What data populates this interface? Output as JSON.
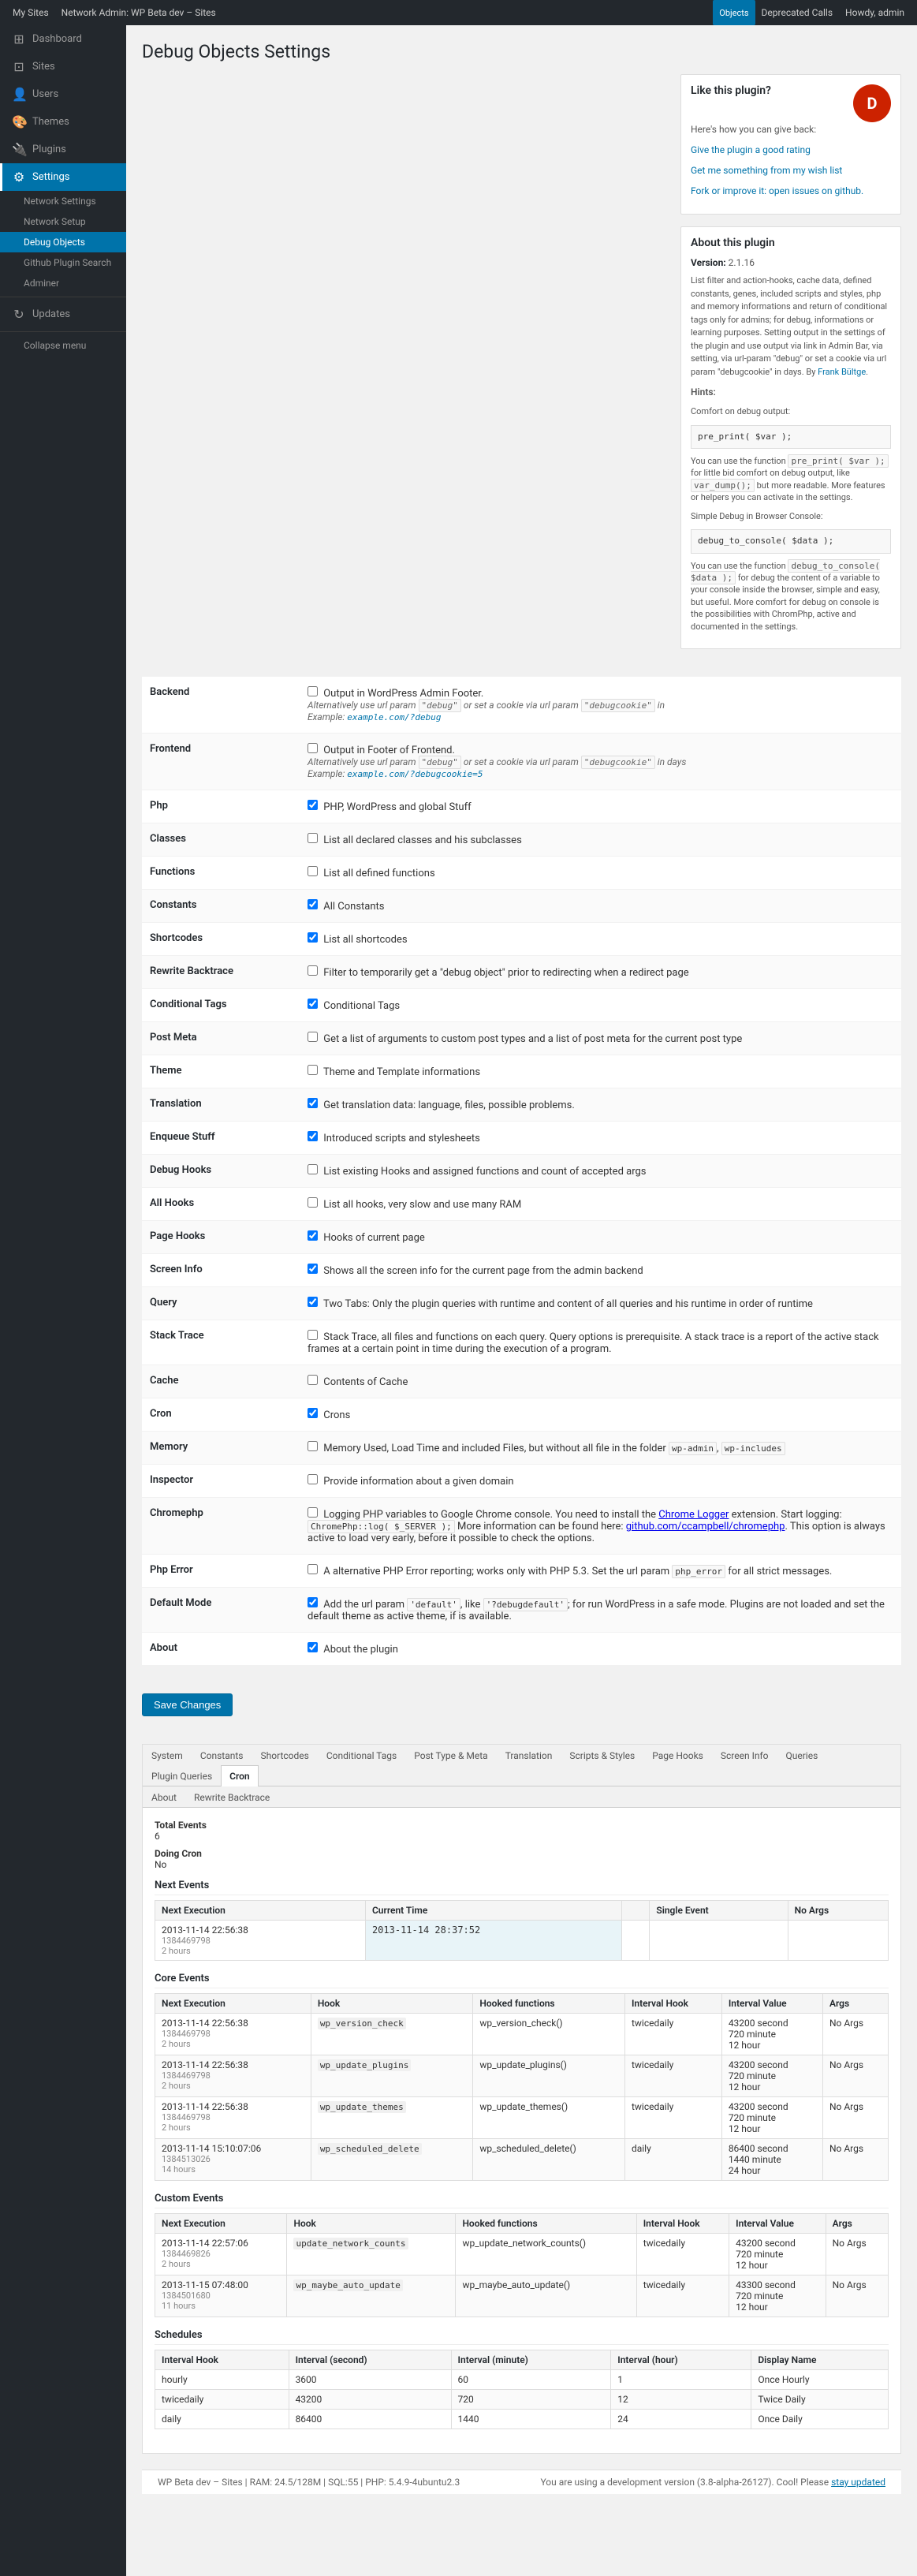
{
  "adminbar": {
    "my_sites": "My Sites",
    "network_admin": "Network Admin: WP Beta dev – Sites",
    "objects": "Objects",
    "deprecated_calls": "Deprecated Calls",
    "howdy": "Howdy, admin"
  },
  "sidebar": {
    "items": [
      {
        "id": "dashboard",
        "label": "Dashboard",
        "icon": "⊞"
      },
      {
        "id": "sites",
        "label": "Sites",
        "icon": "⊞"
      },
      {
        "id": "users",
        "label": "Users",
        "icon": "👤"
      },
      {
        "id": "themes",
        "label": "Themes",
        "icon": "🎨"
      },
      {
        "id": "plugins",
        "label": "Plugins",
        "icon": "🔌"
      },
      {
        "id": "settings",
        "label": "Settings",
        "icon": "⚙",
        "current": true
      }
    ],
    "settings_submenu": [
      {
        "id": "network-settings",
        "label": "Network Settings"
      },
      {
        "id": "network-setup",
        "label": "Network Setup"
      },
      {
        "id": "debug-objects",
        "label": "Debug Objects",
        "current": true
      },
      {
        "id": "github-plugin-search",
        "label": "Github Plugin Search"
      },
      {
        "id": "adminer",
        "label": "Adminer"
      }
    ],
    "updates": "Updates",
    "collapse": "Collapse menu"
  },
  "page": {
    "title": "Debug Objects Settings"
  },
  "like_plugin": {
    "title": "Like this plugin?",
    "body": "Here's how you can give back:",
    "links": [
      "Give the plugin a good rating",
      "Get me something from my wish list",
      "Fork or improve it: open issues on github."
    ]
  },
  "about_plugin": {
    "title": "About this plugin",
    "version_label": "Version:",
    "version_value": "2.1.16",
    "description": "List filter and action-hooks, cache data, defined constants, genes, included scripts and styles, php and memory informations and return of conditional tags only for admins; for debug, informations or learning purposes. Setting output in the settings of the plugin and use output via link in Admin Bar, via setting, via url-param \"debug\" or set a cookie via url param \"debugcookie\" in days. By Frank Bültge.",
    "hints_title": "Hints:",
    "hint1": "Comfort on debug output:",
    "code1": "pre_print( $var );",
    "hint2": "You can use the function pre_print( $var ); for little bid comfort on debug output, like var_dump(); but more readable. More features or helpers you can activate in the settings.",
    "hint3": "Simple Debug in Browser Console:",
    "code2": "debug_to_console( $data );",
    "hint4": "You can use the function debug_to_console( $data ); for debug the content of a variable to your console inside the browser, simple and easy, but useful. More comfort for debug on console is the possibilities with ChromPhp, active and documented in the settings."
  },
  "form_fields": [
    {
      "id": "backend",
      "label": "Backend",
      "checkbox": false,
      "text": "Output in WordPress Admin Footer.",
      "detail": "Alternatively use url param \"debug\" or set a cookie via url param \"debugcookie\" in",
      "example_label": "Example:",
      "example_value": "example.com/?debug"
    },
    {
      "id": "frontend",
      "label": "Frontend",
      "checkbox": false,
      "text": "Output in Footer of Frontend.",
      "detail": "Alternatively use url param \"debug\" or set a cookie via url param \"debugcookie\" in days",
      "example_label": "Example:",
      "example_value": "example.com/?debugcookie=5"
    },
    {
      "id": "php",
      "label": "Php",
      "checkbox": true,
      "text": "PHP, WordPress and global Stuff"
    },
    {
      "id": "classes",
      "label": "Classes",
      "checkbox": false,
      "text": "List all declared classes and his subclasses"
    },
    {
      "id": "functions",
      "label": "Functions",
      "checkbox": false,
      "text": "List all defined functions"
    },
    {
      "id": "constants",
      "label": "Constants",
      "checkbox": true,
      "text": "All Constants"
    },
    {
      "id": "shortcodes",
      "label": "Shortcodes",
      "checkbox": true,
      "text": "List all shortcodes"
    },
    {
      "id": "rewrite-backtrace",
      "label": "Rewrite Backtrace",
      "checkbox": false,
      "text": "Filter to temporarily get a \"debug object\" prior to redirecting when a redirect page"
    },
    {
      "id": "conditional-tags",
      "label": "Conditional Tags",
      "checkbox": true,
      "text": "Conditional Tags"
    },
    {
      "id": "post-meta",
      "label": "Post Meta",
      "checkbox": false,
      "text": "Get a list of arguments to custom post types and a list of post meta for the current post type"
    },
    {
      "id": "theme",
      "label": "Theme",
      "checkbox": false,
      "text": "Theme and Template informations"
    },
    {
      "id": "translation",
      "label": "Translation",
      "checkbox": true,
      "text": "Get translation data: language, files, possible problems."
    },
    {
      "id": "enqueue-stuff",
      "label": "Enqueue Stuff",
      "checkbox": true,
      "text": "Introduced scripts and stylesheets"
    },
    {
      "id": "debug-hooks",
      "label": "Debug Hooks",
      "checkbox": false,
      "text": "List existing Hooks and assigned functions and count of accepted args"
    },
    {
      "id": "all-hooks",
      "label": "All Hooks",
      "checkbox": false,
      "text": "List all hooks, very slow and use many RAM"
    },
    {
      "id": "page-hooks",
      "label": "Page Hooks",
      "checkbox": true,
      "text": "Hooks of current page"
    },
    {
      "id": "screen-info",
      "label": "Screen Info",
      "checkbox": true,
      "text": "Shows all the screen info for the current page from the admin backend"
    },
    {
      "id": "query",
      "label": "Query",
      "checkbox": true,
      "text": "Two Tabs: Only the plugin queries with runtime and content of all queries and his runtime in order of runtime"
    },
    {
      "id": "stack-trace",
      "label": "Stack Trace",
      "checkbox": false,
      "text": "Stack Trace, all files and functions on each query. Query options is prerequisite. A stack trace is a report of the active stack frames at a certain point in time during the execution of a program."
    },
    {
      "id": "cache",
      "label": "Cache",
      "checkbox": false,
      "text": "Contents of Cache"
    },
    {
      "id": "cron",
      "label": "Cron",
      "checkbox": true,
      "text": "Crons"
    },
    {
      "id": "memory",
      "label": "Memory",
      "checkbox": false,
      "text": "Memory Used, Load Time and included Files, but without all file in the folder wp-admin, wp-includes"
    },
    {
      "id": "inspector",
      "label": "Inspector",
      "checkbox": false,
      "text": "Provide information about a given domain"
    },
    {
      "id": "chromephp",
      "label": "Chromephp",
      "checkbox": false,
      "text": "Logging PHP variables to Google Chrome console. You need to install the Chrome Logger extension. Start logging: ChromePhp::log( $_SERVER ); More information can be found here: github.com/ccampbell/chromephp. This option is always active to load very early, before it possible to check the options."
    },
    {
      "id": "php-error",
      "label": "Php Error",
      "checkbox": false,
      "text": "A alternative PHP Error reporting; works only with PHP 5.3. Set the url param php_error for all strict messages."
    },
    {
      "id": "default-mode",
      "label": "Default Mode",
      "checkbox": true,
      "text": "Add the url param 'default', like '?debugdefault'; for run WordPress in a safe mode. Plugins are not loaded and set the default theme as active theme, if is available."
    },
    {
      "id": "about",
      "label": "About",
      "checkbox": true,
      "text": "About the plugin"
    }
  ],
  "save_button": "Save Changes",
  "cron_tabs": [
    {
      "id": "system",
      "label": "System"
    },
    {
      "id": "constants",
      "label": "Constants"
    },
    {
      "id": "shortcodes",
      "label": "Shortcodes"
    },
    {
      "id": "conditional-tags",
      "label": "Conditional Tags"
    },
    {
      "id": "post-type-meta",
      "label": "Post Type & Meta"
    },
    {
      "id": "translation",
      "label": "Translation"
    },
    {
      "id": "scripts-styles",
      "label": "Scripts & Styles"
    },
    {
      "id": "page-hooks",
      "label": "Page Hooks"
    },
    {
      "id": "screen-info",
      "label": "Screen Info"
    },
    {
      "id": "queries",
      "label": "Queries"
    },
    {
      "id": "plugin-queries",
      "label": "Plugin Queries"
    },
    {
      "id": "cron",
      "label": "Cron",
      "active": true
    }
  ],
  "cron_tabs2": [
    {
      "id": "about",
      "label": "About"
    },
    {
      "id": "rewrite-backtrace",
      "label": "Rewrite Backtrace"
    }
  ],
  "cron_data": {
    "total_events_label": "Total Events",
    "total_events_value": "6",
    "doing_cron_label": "Doing Cron",
    "doing_cron_value": "No",
    "next_events_label": "Next Events",
    "next_events_headers": [
      "Next Execution",
      "Current Time",
      "",
      "Single Event",
      "No Args"
    ],
    "next_events": [
      {
        "next_exec": "2013-11-14 22:56:38",
        "timestamp": "1384469798",
        "interval": "2 hours",
        "current_time": "2013-11-14 28:37:52",
        "single": "",
        "no_args": ""
      }
    ],
    "core_events_label": "Core Events",
    "core_events_headers": [
      "Next Execution",
      "Hook",
      "Hooked functions",
      "Interval Hook",
      "Interval Value",
      "Args"
    ],
    "core_events": [
      {
        "next_exec": "2013-11-14 22:56:38",
        "timestamp": "1384469798",
        "interval": "2 hours",
        "hook": "wp_version_check",
        "hooked": "wp_version_check()",
        "interval_hook": "twicedaily",
        "interval_value": "43200 second",
        "interval_value2": "720 minute",
        "interval_value3": "12 hour",
        "args": "No Args"
      },
      {
        "next_exec": "2013-11-14 22:56:38",
        "timestamp": "1384469798",
        "interval": "2 hours",
        "hook": "wp_update_plugins",
        "hooked": "wp_update_plugins()",
        "interval_hook": "twicedaily",
        "interval_value": "43200 second",
        "interval_value2": "720 minute",
        "interval_value3": "12 hour",
        "args": "No Args"
      },
      {
        "next_exec": "2013-11-14 22:56:38",
        "timestamp": "1384469798",
        "interval": "2 hours",
        "hook": "wp_update_themes",
        "hooked": "wp_update_themes()",
        "interval_hook": "twicedaily",
        "interval_value": "43200 second",
        "interval_value2": "720 minute",
        "interval_value3": "12 hour",
        "args": "No Args"
      },
      {
        "next_exec": "2013-11-14 15:10:07:06",
        "timestamp": "1384513026",
        "interval": "14 hours",
        "hook": "wp_scheduled_delete",
        "hooked": "wp_scheduled_delete()",
        "interval_hook": "daily",
        "interval_value": "86400 second",
        "interval_value2": "1440 minute",
        "interval_value3": "24 hour",
        "args": "No Args"
      }
    ],
    "custom_events_label": "Custom Events",
    "custom_events_headers": [
      "Next Execution",
      "Hook",
      "Hooked functions",
      "Interval Hook",
      "Interval Value",
      "Args"
    ],
    "custom_events": [
      {
        "next_exec": "2013-11-14 22:57:06",
        "timestamp": "1384469826",
        "interval": "2 hours",
        "hook": "update_network_counts",
        "hooked": "wp_update_network_counts()",
        "interval_hook": "twicedaily",
        "interval_value": "43200 second",
        "interval_value2": "720 minute",
        "interval_value3": "12 hour",
        "args": "No Args"
      },
      {
        "next_exec": "2013-11-15 07:48:00",
        "timestamp": "1384501680",
        "interval": "11 hours",
        "hook": "wp_maybe_auto_update",
        "hooked": "wp_maybe_auto_update()",
        "interval_hook": "twicedaily",
        "interval_value": "43300 second",
        "interval_value2": "720 minute",
        "interval_value3": "12 hour",
        "args": "No Args"
      }
    ],
    "schedules_label": "Schedules",
    "schedules_headers": [
      "Interval Hook",
      "Interval (second)",
      "Interval (minute)",
      "Interval (hour)",
      "Display Name"
    ],
    "schedules": [
      {
        "hook": "hourly",
        "seconds": "3600",
        "minutes": "60",
        "hours": "1",
        "display": "Once Hourly"
      },
      {
        "hook": "twicedaily",
        "seconds": "43200",
        "minutes": "720",
        "hours": "12",
        "display": "Twice Daily"
      },
      {
        "hook": "daily",
        "seconds": "86400",
        "minutes": "1440",
        "hours": "24",
        "display": "Once Daily"
      }
    ]
  },
  "footer": {
    "left": "WP Beta dev – Sites | RAM: 24.5/128M | SQL:55 | PHP: 5.4.9-4ubuntu2.3",
    "right_prefix": "You are using a development version (3.8-alpha-26127). Cool! Please",
    "right_link": "stay updated"
  }
}
